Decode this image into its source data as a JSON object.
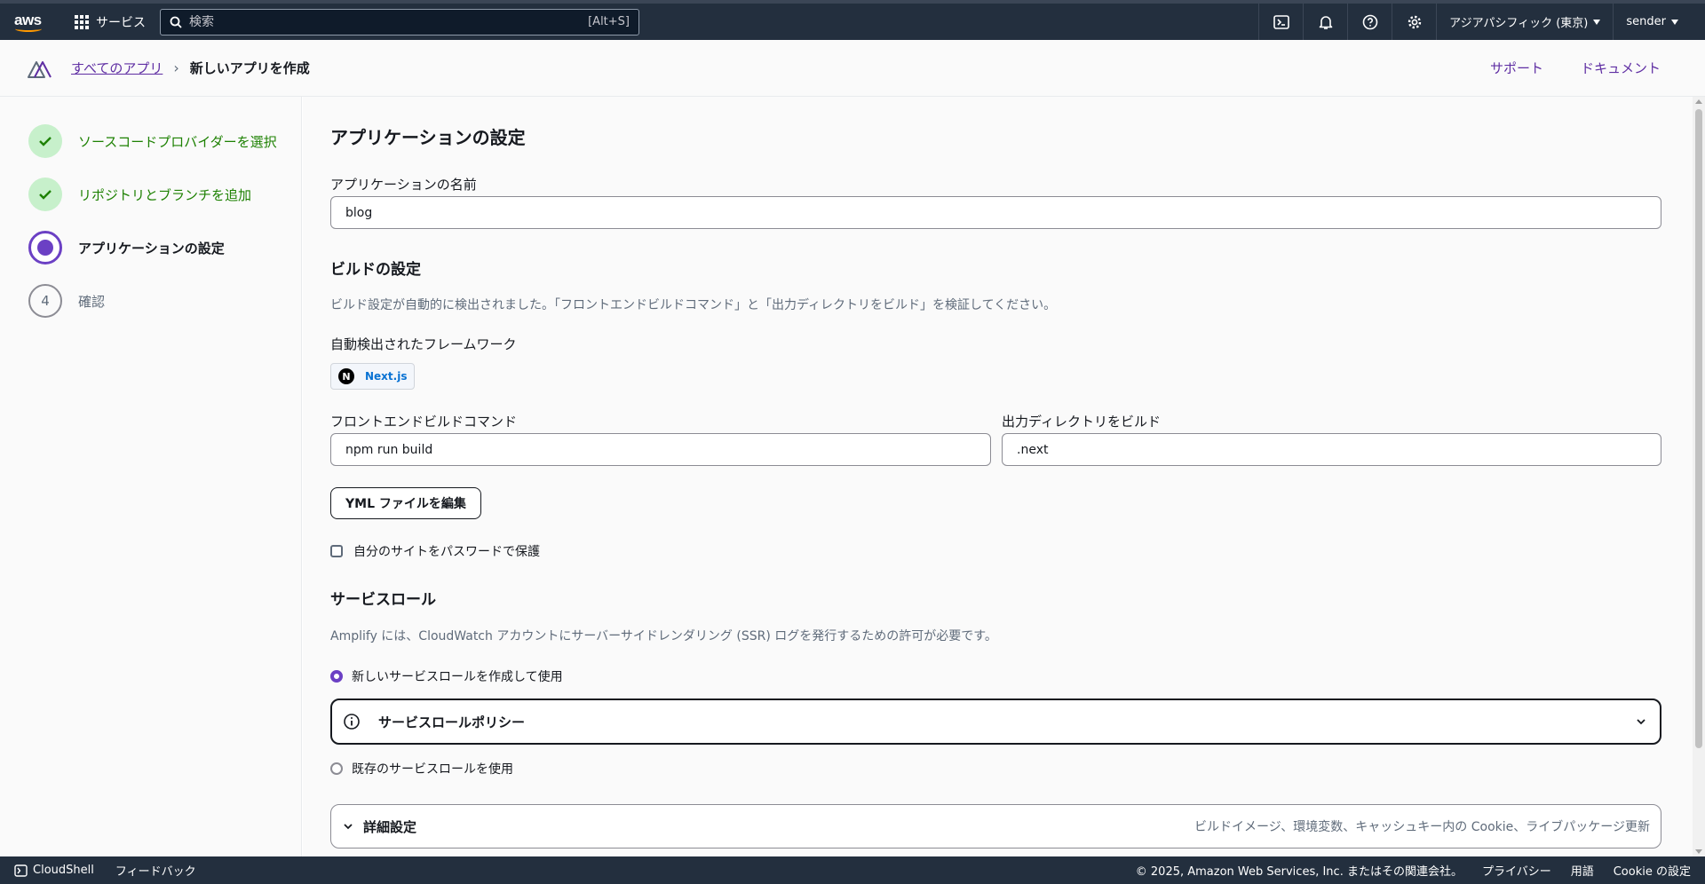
{
  "topbar": {
    "logo_text": "aws",
    "services_label": "サービス",
    "search_placeholder": "検索",
    "search_shortcut": "[Alt+S]",
    "region": "アジアパシフィック (東京)",
    "user": "sender"
  },
  "header": {
    "all_apps": "すべてのアプリ",
    "current": "新しいアプリを作成",
    "support": "サポート",
    "docs": "ドキュメント"
  },
  "steps": [
    {
      "label": "ソースコードプロバイダーを選択",
      "state": "done"
    },
    {
      "label": "リポジトリとブランチを追加",
      "state": "done"
    },
    {
      "label": "アプリケーションの設定",
      "state": "current"
    },
    {
      "label": "確認",
      "state": "todo",
      "number": "4"
    }
  ],
  "main": {
    "title": "アプリケーションの設定",
    "app_name_label": "アプリケーションの名前",
    "app_name_value": "blog",
    "build": {
      "heading": "ビルドの設定",
      "description": "ビルド設定が自動的に検出されました。「フロントエンドビルドコマンド」と「出力ディレクトリをビルド」を検証してください。",
      "framework_label": "自動検出されたフレームワーク",
      "framework_logo": "N",
      "framework_name": "Next.js",
      "command_label": "フロントエンドビルドコマンド",
      "command_value": "npm run build",
      "output_label": "出力ディレクトリをビルド",
      "output_value": ".next",
      "yml_button": "YML ファイルを編集",
      "password_label": "自分のサイトをパスワードで保護"
    },
    "service_role": {
      "heading": "サービスロール",
      "description": "Amplify には、CloudWatch アカウントにサーバーサイドレンダリング (SSR) ログを発行するための許可が必要です。",
      "option_new": "新しいサービスロールを作成して使用",
      "policy_title": "サービスロールポリシー",
      "option_existing": "既存のサービスロールを使用"
    },
    "advanced": {
      "title": "詳細設定",
      "description": "ビルドイメージ、環境変数、キャッシュキー内の Cookie、ライブパッケージ更新"
    }
  },
  "footer": {
    "cloudshell": "CloudShell",
    "feedback": "フィードバック",
    "copyright": "© 2025, Amazon Web Services, Inc. またはその関連会社。",
    "privacy": "プライバシー",
    "terms": "用語",
    "cookie": "Cookie の設定"
  },
  "colors": {
    "topbar_bg": "#232f3e",
    "accent": "#6b40c4",
    "link": "#5f2ea3",
    "success": "#1d8102"
  }
}
